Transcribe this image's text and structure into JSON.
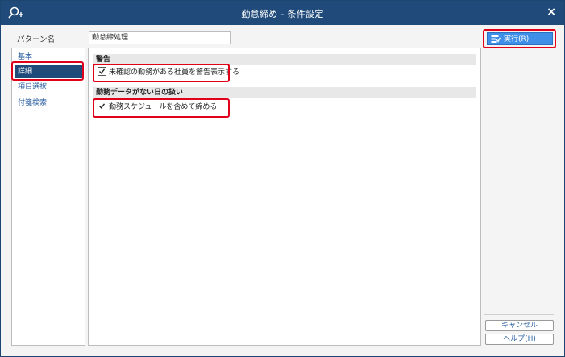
{
  "window": {
    "title": "勤怠締め - 条件設定",
    "close_label": "×",
    "app_icon": "search-plus-icon"
  },
  "pattern": {
    "label": "パターン名",
    "value": "勤怠締処理"
  },
  "nav": {
    "items": [
      {
        "label": "基本",
        "active": false
      },
      {
        "label": "詳細",
        "active": true
      },
      {
        "label": "項目選択",
        "active": false
      },
      {
        "label": "付箋検索",
        "active": false
      }
    ]
  },
  "sections": [
    {
      "header": "警告",
      "checkbox": {
        "label": "未確認の勤務がある社員を警告表示する",
        "checked": true
      }
    },
    {
      "header": "勤務データがない日の扱い",
      "checkbox": {
        "label": "勤務スケジュールを含めて締める",
        "checked": true
      }
    }
  ],
  "buttons": {
    "execute": "実行(R)",
    "cancel": "キャンセル",
    "help": "ヘルプ(H)"
  },
  "colors": {
    "titlebar": "#1f4a7a",
    "accent": "#3f8fe8",
    "highlight": "#e0001a",
    "link": "#2b5fa0"
  }
}
